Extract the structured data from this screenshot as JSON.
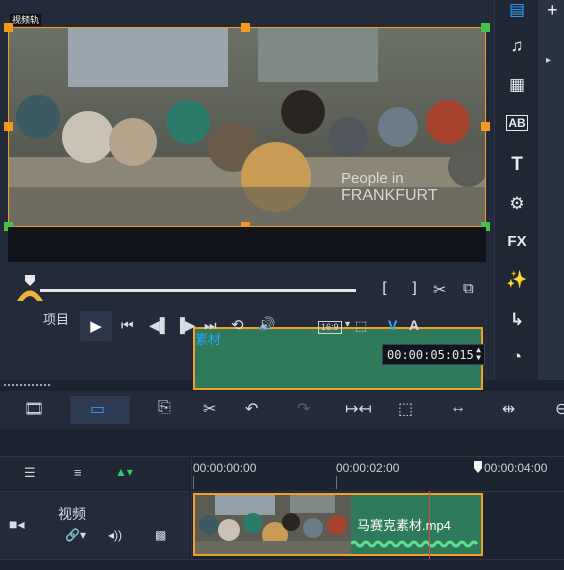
{
  "preview": {
    "track_tag": "视频轨",
    "overlay_line1": "People in",
    "overlay_line2": "FRANKFURT"
  },
  "player": {
    "mode_project": "项目",
    "mode_clip": "素材",
    "bracket_in": "[",
    "bracket_out": "]",
    "aspect": "16:9",
    "timecode": "00:00:05:015"
  },
  "right_bar": {
    "items": [
      "media-icon",
      "audio-icon",
      "instant-project-icon",
      "title-icon",
      "text-icon",
      "transition-icon",
      "fx-icon",
      "filter-magic-icon",
      "path-icon",
      "speedometer-icon"
    ],
    "fx_label": "FX",
    "title_label": "AB",
    "text_label": "T"
  },
  "timeline": {
    "ruler": [
      "00:00:00:00",
      "00:00:02:00",
      "00:00:04:00"
    ],
    "track_name": "视频",
    "clip_name": "马赛克素材.mp4"
  },
  "colors": {
    "accent": "#f39a1e",
    "clip_fill": "#2f7a5a",
    "active_blue": "#2ea3ff"
  }
}
